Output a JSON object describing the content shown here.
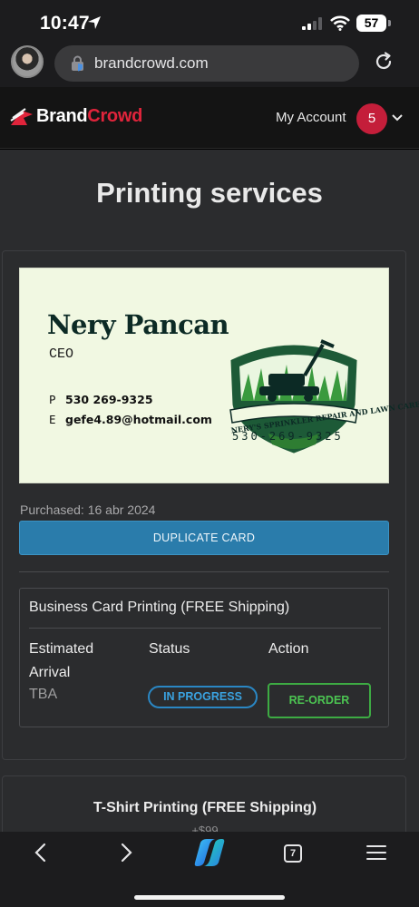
{
  "status_bar": {
    "time": "10:47",
    "battery": "57"
  },
  "browser": {
    "url": "brandcrowd.com"
  },
  "header": {
    "logo_brand": "Brand",
    "logo_crowd": "Crowd",
    "account_label": "My Account",
    "notification_count": "5"
  },
  "page": {
    "title": "Printing services"
  },
  "order": {
    "card": {
      "name": "Nery Pancan",
      "role": "CEO",
      "phone_key": "P",
      "phone": "530 269-9325",
      "email_key": "E",
      "email": "gefe4.89@hotmail.com",
      "logo_arc_text": "NERY'S SPRINKLER REPAIR AND LAWN CARE",
      "logo_phone": "530-269-9325"
    },
    "purchased": "Purchased: 16 abr 2024",
    "duplicate_label": "DUPLICATE CARD",
    "printing": {
      "title": "Business Card Printing (FREE Shipping)",
      "col_arrival": "Estimated Arrival",
      "col_status": "Status",
      "col_action": "Action",
      "arrival_value": "TBA",
      "status_value": "IN PROGRESS",
      "action_label": "RE-ORDER"
    }
  },
  "tshirt": {
    "title": "T-Shirt Printing (FREE Shipping)",
    "price": "+$99"
  },
  "toolbar": {
    "tab_count": "7"
  },
  "colors": {
    "brand_red": "#e0243b",
    "badge_red": "#c41e3a",
    "primary_blue": "#2a7cab",
    "status_blue": "#2a87c4",
    "action_green": "#3dab43"
  }
}
